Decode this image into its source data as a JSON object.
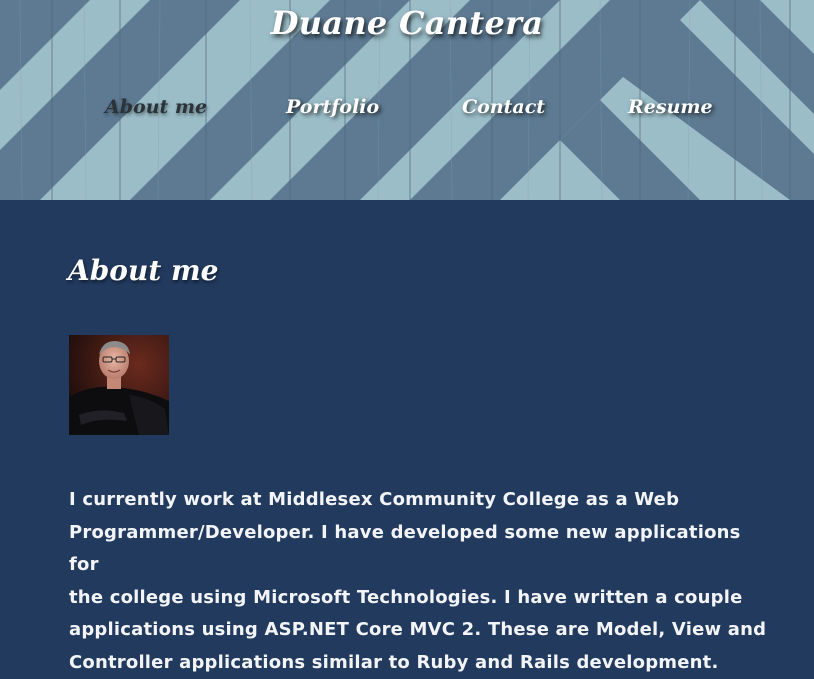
{
  "site": {
    "title": "Duane Cantera"
  },
  "nav": {
    "items": [
      {
        "label": "About me",
        "active": true
      },
      {
        "label": "Portfolio",
        "active": false
      },
      {
        "label": "Contact",
        "active": false
      },
      {
        "label": "Resume",
        "active": false
      }
    ]
  },
  "main": {
    "heading": "About me",
    "bio_lines": [
      "I currently work at Middlesex Community College as a Web",
      "Programmer/Developer. I have developed some new applications for",
      "the college using Microsoft Technologies. I have written a couple",
      "applications using ASP.NET Core MVC 2. These are Model, View and",
      "Controller applications similar to Ruby and Rails development."
    ]
  },
  "colors": {
    "header_light": "#9bbdc8",
    "header_dark": "#5d7a92",
    "main_bg": "#223a5e",
    "active_nav": "#2b3238",
    "text": "#ffffff"
  }
}
